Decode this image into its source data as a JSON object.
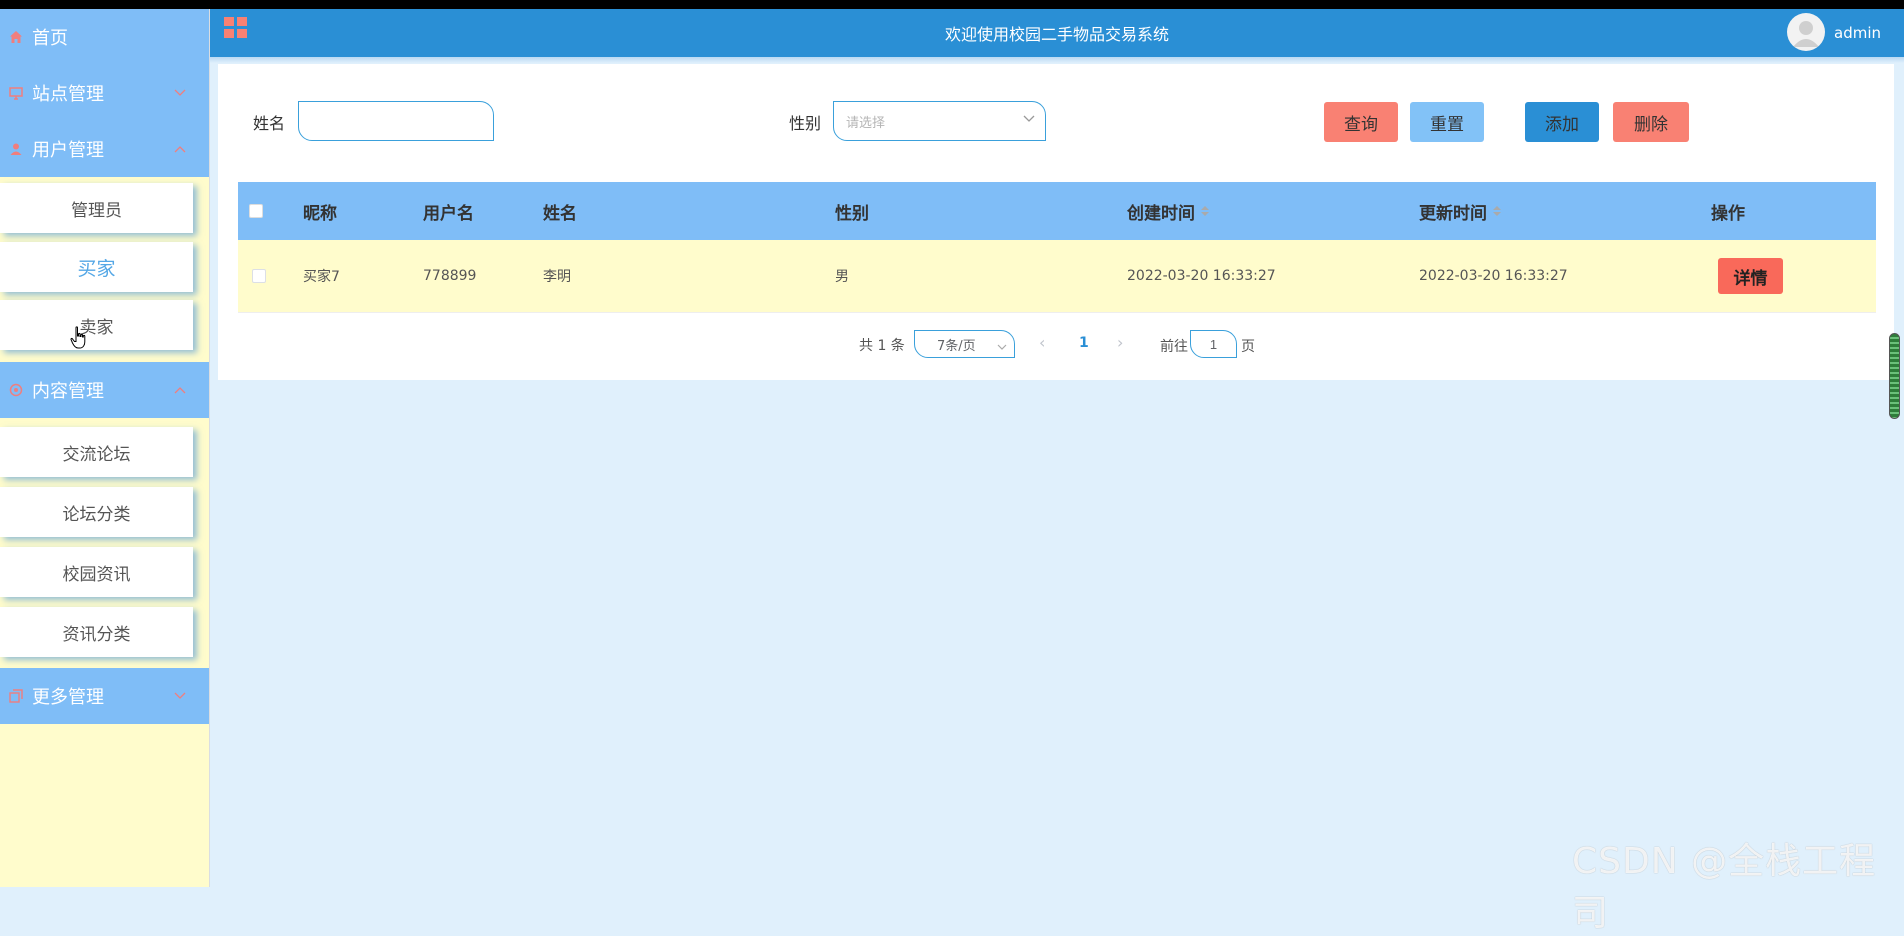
{
  "header": {
    "title": "欢迎使用校园二手物品交易系统",
    "username": "admin"
  },
  "sidebar": {
    "home": {
      "label": "首页",
      "icon": "home-icon"
    },
    "sections": [
      {
        "label": "站点管理",
        "icon": "monitor-icon",
        "expanded": false
      },
      {
        "label": "用户管理",
        "icon": "user-icon",
        "expanded": true
      },
      {
        "label": "内容管理",
        "icon": "chat-icon",
        "expanded": true
      },
      {
        "label": "更多管理",
        "icon": "copy-icon",
        "expanded": false
      }
    ],
    "user_items": [
      "管理员",
      "买家",
      "卖家"
    ],
    "content_items": [
      "交流论坛",
      "论坛分类",
      "校园资讯",
      "资讯分类"
    ],
    "active_item": "买家"
  },
  "search": {
    "name_label": "姓名",
    "name_value": "",
    "gender_label": "性别",
    "gender_placeholder": "请选择"
  },
  "buttons": {
    "query": "查询",
    "reset": "重置",
    "add": "添加",
    "delete": "删除"
  },
  "table": {
    "columns": [
      "昵称",
      "用户名",
      "姓名",
      "性别",
      "创建时间",
      "更新时间",
      "操作"
    ],
    "rows": [
      {
        "nickname": "买家7",
        "username": "778899",
        "name": "李明",
        "gender": "男",
        "created": "2022-03-20 16:33:27",
        "updated": "2022-03-20 16:33:27",
        "action": "详情"
      }
    ]
  },
  "pagination": {
    "total_text": "共 1 条",
    "page_size": "7条/页",
    "current_page": "1",
    "goto_prefix": "前往",
    "goto_value": "1",
    "goto_suffix": "页"
  },
  "watermark": "CSDN @全栈工程司",
  "colors": {
    "sidebar_bg": "#fffccc",
    "menu_head": "#7fbdf7",
    "header": "#2a8fd5",
    "danger": "#f98173",
    "row_bg": "#fffccc"
  }
}
